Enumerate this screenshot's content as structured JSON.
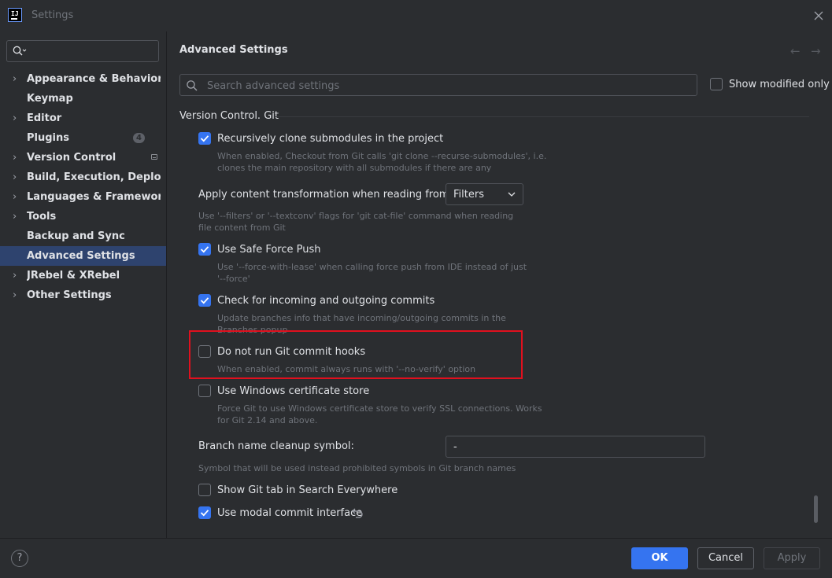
{
  "window": {
    "title": "Settings",
    "logo_text": "IJ"
  },
  "sidebar": {
    "search_placeholder": "",
    "items": [
      {
        "label": "Appearance & Behavior",
        "expandable": true
      },
      {
        "label": "Keymap",
        "expandable": false
      },
      {
        "label": "Editor",
        "expandable": true
      },
      {
        "label": "Plugins",
        "expandable": false,
        "badge": "4"
      },
      {
        "label": "Version Control",
        "expandable": true,
        "project_icon": true
      },
      {
        "label": "Build, Execution, Deployment",
        "expandable": true
      },
      {
        "label": "Languages & Frameworks",
        "expandable": true
      },
      {
        "label": "Tools",
        "expandable": true
      },
      {
        "label": "Backup and Sync",
        "expandable": false
      },
      {
        "label": "Advanced Settings",
        "expandable": false,
        "selected": true
      },
      {
        "label": "JRebel & XRebel",
        "expandable": true
      },
      {
        "label": "Other Settings",
        "expandable": true
      }
    ]
  },
  "main": {
    "title": "Advanced Settings",
    "search_placeholder": "Search advanced settings",
    "show_modified_label": "Show modified only",
    "show_modified_checked": false,
    "section": "Version Control. Git",
    "options": {
      "recursive_clone": {
        "label": "Recursively clone submodules in the project",
        "checked": true,
        "desc": "When enabled, Checkout from Git calls 'git clone --recurse-submodules', i.e. clones the main repository with all submodules if there are any"
      },
      "content_transformation": {
        "label": "Apply content transformation when reading from Git:",
        "value": "Filters",
        "desc": "Use '--filters' or '--textconv' flags for 'git cat-file' command when reading file content from Git"
      },
      "safe_force_push": {
        "label": "Use Safe Force Push",
        "checked": true,
        "desc": "Use '--force-with-lease' when calling force push from IDE instead of just '--force'"
      },
      "incoming_outgoing": {
        "label": "Check for incoming and outgoing commits",
        "checked": true,
        "desc": "Update branches info that have incoming/outgoing commits in the Branches popup"
      },
      "no_commit_hooks": {
        "label": "Do not run Git commit hooks",
        "checked": false,
        "desc": "When enabled, commit always runs with '--no-verify' option"
      },
      "windows_cert": {
        "label": "Use Windows certificate store",
        "checked": false,
        "desc": "Force Git to use Windows certificate store to verify SSL connections. Works for Git 2.14 and above."
      },
      "branch_cleanup": {
        "label": "Branch name cleanup symbol:",
        "value": "-",
        "desc": "Symbol that will be used instead prohibited symbols in Git branch names"
      },
      "git_tab_search": {
        "label": "Show Git tab in Search Everywhere",
        "checked": false
      },
      "modal_commit": {
        "label": "Use modal commit interface",
        "checked": true
      }
    }
  },
  "footer": {
    "help": "?",
    "ok": "OK",
    "cancel": "Cancel",
    "apply": "Apply"
  },
  "colors": {
    "accent": "#3574f0",
    "background": "#2b2d30",
    "selection": "#2e436e",
    "highlight_box": "#e0101e"
  }
}
